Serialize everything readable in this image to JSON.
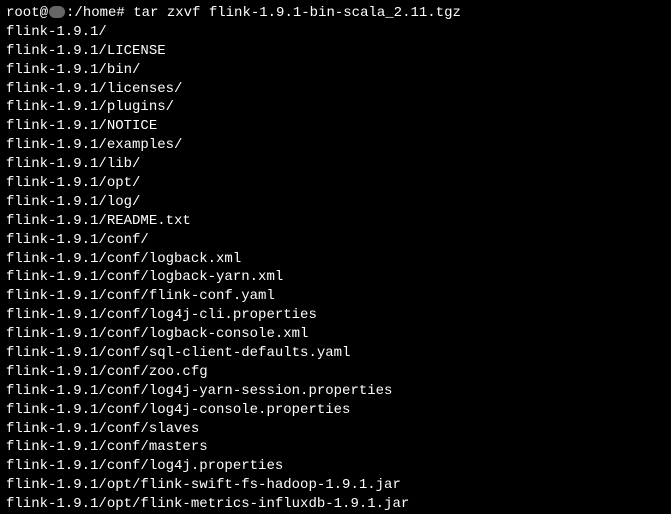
{
  "prompt": {
    "user": "root@",
    "host_suffix": ":/home#",
    "command": "tar zxvf flink-1.9.1-bin-scala_2.11.tgz"
  },
  "lines": [
    "flink-1.9.1/",
    "flink-1.9.1/LICENSE",
    "flink-1.9.1/bin/",
    "flink-1.9.1/licenses/",
    "flink-1.9.1/plugins/",
    "flink-1.9.1/NOTICE",
    "flink-1.9.1/examples/",
    "flink-1.9.1/lib/",
    "flink-1.9.1/opt/",
    "flink-1.9.1/log/",
    "flink-1.9.1/README.txt",
    "flink-1.9.1/conf/",
    "flink-1.9.1/conf/logback.xml",
    "flink-1.9.1/conf/logback-yarn.xml",
    "flink-1.9.1/conf/flink-conf.yaml",
    "flink-1.9.1/conf/log4j-cli.properties",
    "flink-1.9.1/conf/logback-console.xml",
    "flink-1.9.1/conf/sql-client-defaults.yaml",
    "flink-1.9.1/conf/zoo.cfg",
    "flink-1.9.1/conf/log4j-yarn-session.properties",
    "flink-1.9.1/conf/log4j-console.properties",
    "flink-1.9.1/conf/slaves",
    "flink-1.9.1/conf/masters",
    "flink-1.9.1/conf/log4j.properties",
    "flink-1.9.1/opt/flink-swift-fs-hadoop-1.9.1.jar",
    "flink-1.9.1/opt/flink-metrics-influxdb-1.9.1.jar"
  ]
}
